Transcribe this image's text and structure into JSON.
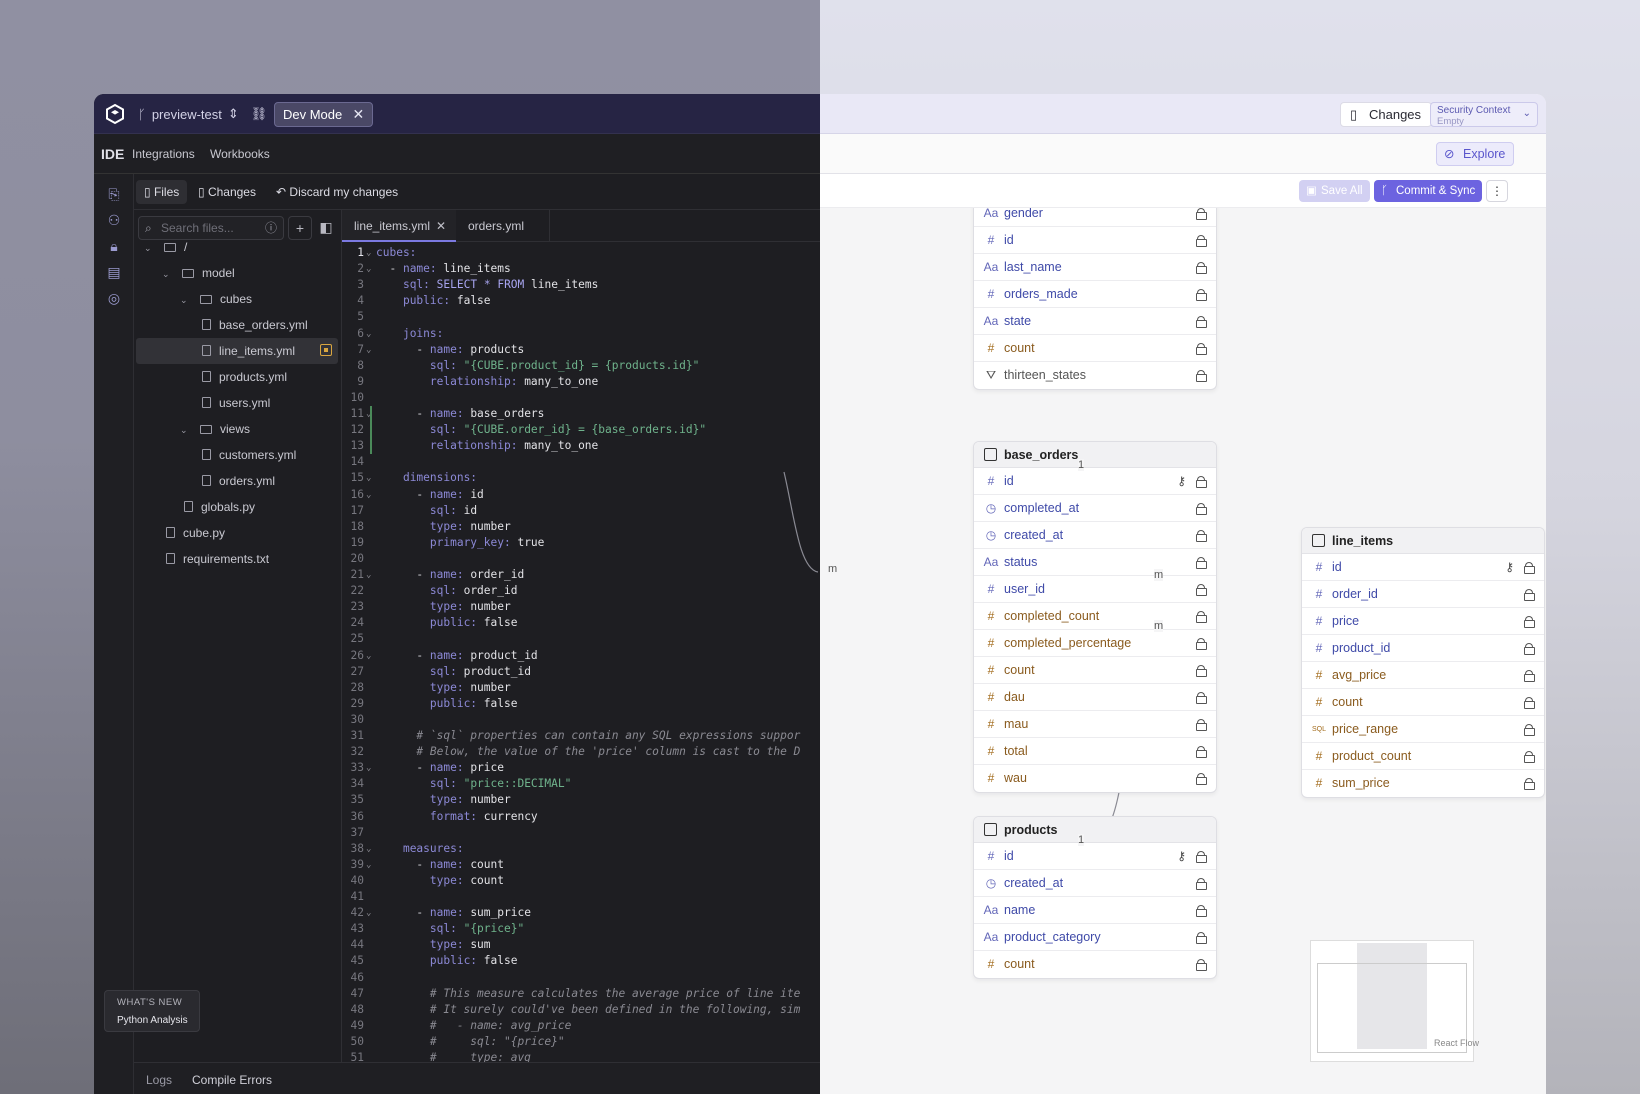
{
  "header": {
    "branch": "preview-test",
    "dev_mode": "Dev Mode",
    "changes": "Changes",
    "security_title": "Security Context",
    "security_value": "Empty"
  },
  "nav": {
    "ide": "IDE",
    "integrations": "Integrations",
    "workbooks": "Workbooks",
    "explore": "Explore"
  },
  "toolbar": {
    "files": "Files",
    "changes": "Changes",
    "discard": "Discard my changes",
    "save_all": "Save All",
    "commit": "Commit & Sync"
  },
  "search": {
    "placeholder": "Search files..."
  },
  "tree": [
    {
      "label": "/",
      "type": "folder",
      "depth": 0,
      "chev": true
    },
    {
      "label": "model",
      "type": "folder",
      "depth": 1,
      "chev": true
    },
    {
      "label": "cubes",
      "type": "folder",
      "depth": 2,
      "chev": true
    },
    {
      "label": "base_orders.yml",
      "type": "file",
      "depth": 3
    },
    {
      "label": "line_items.yml",
      "type": "file",
      "depth": 3,
      "selected": true
    },
    {
      "label": "products.yml",
      "type": "file",
      "depth": 3
    },
    {
      "label": "users.yml",
      "type": "file",
      "depth": 3
    },
    {
      "label": "views",
      "type": "folder",
      "depth": 2,
      "chev": true
    },
    {
      "label": "customers.yml",
      "type": "file",
      "depth": 3
    },
    {
      "label": "orders.yml",
      "type": "file",
      "depth": 3
    },
    {
      "label": "globals.py",
      "type": "file",
      "depth": 2
    },
    {
      "label": "cube.py",
      "type": "file",
      "depth": 1
    },
    {
      "label": "requirements.txt",
      "type": "file",
      "depth": 1
    }
  ],
  "tabs": [
    {
      "label": "line_items.yml",
      "active": true
    },
    {
      "label": "orders.yml",
      "active": false
    }
  ],
  "code": [
    "cubes:",
    "  - name: line_items",
    "    sql: SELECT * FROM line_items",
    "    public: false",
    "",
    "    joins:",
    "      - name: products",
    "        sql: \"{CUBE.product_id} = {products.id}\"",
    "        relationship: many_to_one",
    "",
    "      - name: base_orders",
    "        sql: \"{CUBE.order_id} = {base_orders.id}\"",
    "        relationship: many_to_one",
    "",
    "    dimensions:",
    "      - name: id",
    "        sql: id",
    "        type: number",
    "        primary_key: true",
    "",
    "      - name: order_id",
    "        sql: order_id",
    "        type: number",
    "        public: false",
    "",
    "      - name: product_id",
    "        sql: product_id",
    "        type: number",
    "        public: false",
    "",
    "      # `sql` properties can contain any SQL expressions suppor",
    "      # Below, the value of the 'price' column is cast to the D",
    "      - name: price",
    "        sql: \"price::DECIMAL\"",
    "        type: number",
    "        format: currency",
    "",
    "    measures:",
    "      - name: count",
    "        type: count",
    "",
    "      - name: sum_price",
    "        sql: \"{price}\"",
    "        type: sum",
    "        public: false",
    "",
    "        # This measure calculates the average price of line ite",
    "        # It surely could've been defined in the following, sim",
    "        #   - name: avg_price",
    "        #     sql: \"{price}\"",
    "        #     type: avg"
  ],
  "folds": [
    1,
    2,
    6,
    7,
    11,
    15,
    16,
    21,
    26,
    33,
    38,
    39,
    42
  ],
  "whats_new": {
    "title": "WHAT'S NEW",
    "item": "Python Analysis"
  },
  "bottom": {
    "logs": "Logs",
    "compile": "Compile Errors"
  },
  "cards": {
    "users": {
      "fields": [
        {
          "name": "gender",
          "kind": "string"
        },
        {
          "name": "id",
          "kind": "number"
        },
        {
          "name": "last_name",
          "kind": "string"
        },
        {
          "name": "orders_made",
          "kind": "number"
        },
        {
          "name": "state",
          "kind": "string"
        },
        {
          "name": "count",
          "kind": "measure"
        },
        {
          "name": "thirteen_states",
          "kind": "segment"
        }
      ]
    },
    "base_orders": {
      "title": "base_orders",
      "fields": [
        {
          "name": "id",
          "kind": "number",
          "key": true
        },
        {
          "name": "completed_at",
          "kind": "time"
        },
        {
          "name": "created_at",
          "kind": "time"
        },
        {
          "name": "status",
          "kind": "string"
        },
        {
          "name": "user_id",
          "kind": "number"
        },
        {
          "name": "completed_count",
          "kind": "measure"
        },
        {
          "name": "completed_percentage",
          "kind": "measure"
        },
        {
          "name": "count",
          "kind": "measure"
        },
        {
          "name": "dau",
          "kind": "measure"
        },
        {
          "name": "mau",
          "kind": "measure"
        },
        {
          "name": "total",
          "kind": "measure"
        },
        {
          "name": "wau",
          "kind": "measure"
        }
      ]
    },
    "products": {
      "title": "products",
      "fields": [
        {
          "name": "id",
          "kind": "number",
          "key": true
        },
        {
          "name": "created_at",
          "kind": "time"
        },
        {
          "name": "name",
          "kind": "string"
        },
        {
          "name": "product_category",
          "kind": "string"
        },
        {
          "name": "count",
          "kind": "measure"
        }
      ]
    },
    "line_items": {
      "title": "line_items",
      "fields": [
        {
          "name": "id",
          "kind": "number",
          "key": true
        },
        {
          "name": "order_id",
          "kind": "number"
        },
        {
          "name": "price",
          "kind": "number"
        },
        {
          "name": "product_id",
          "kind": "number"
        },
        {
          "name": "avg_price",
          "kind": "measure"
        },
        {
          "name": "count",
          "kind": "measure"
        },
        {
          "name": "price_range",
          "kind": "sql"
        },
        {
          "name": "product_count",
          "kind": "measure"
        },
        {
          "name": "sum_price",
          "kind": "measure"
        }
      ]
    }
  },
  "edge_labels": {
    "one": "1",
    "many": "m"
  },
  "react_flow": "React Flow"
}
